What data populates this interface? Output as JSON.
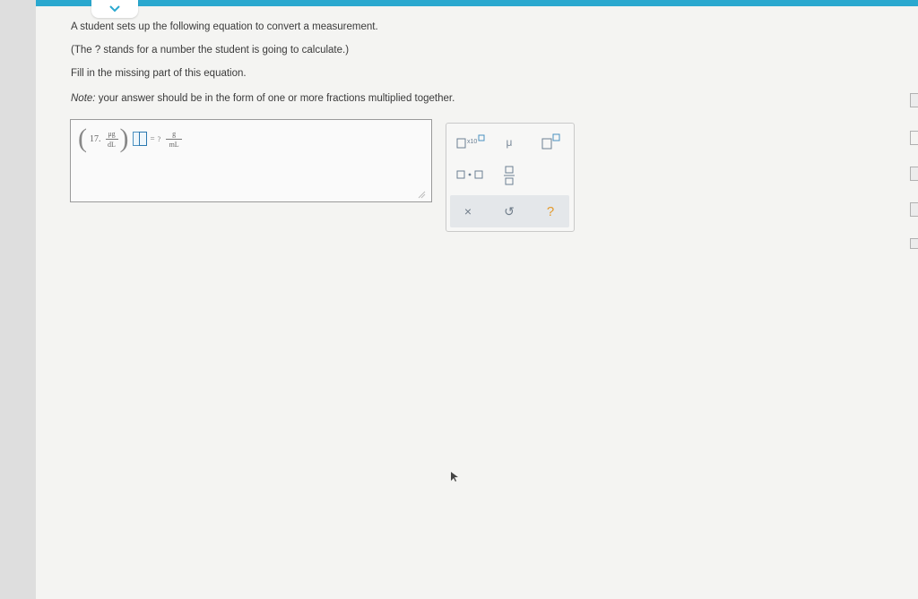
{
  "prompt": {
    "line1": "A student sets up the following equation to convert a measurement.",
    "line2": "(The ? stands for a number the student is going to calculate.)",
    "line3": "Fill in the missing part of this equation.",
    "note_label": "Note:",
    "note_text": " your answer should be in the form of one or more fractions multiplied together."
  },
  "equation": {
    "coefficient": "17.",
    "lhs_numerator": "μg",
    "lhs_denominator": "dL",
    "equals": "=",
    "unknown": "?",
    "rhs_numerator": "g",
    "rhs_denominator": "mL"
  },
  "palette": {
    "sci_label": "x10",
    "mu_label": "μ",
    "mul_dot": "·",
    "clear_label": "×",
    "undo_label": "↺",
    "help_label": "?"
  },
  "colors": {
    "accent": "#2aa8cf",
    "slot_border": "#4a90c0",
    "help": "#e39a2d"
  }
}
